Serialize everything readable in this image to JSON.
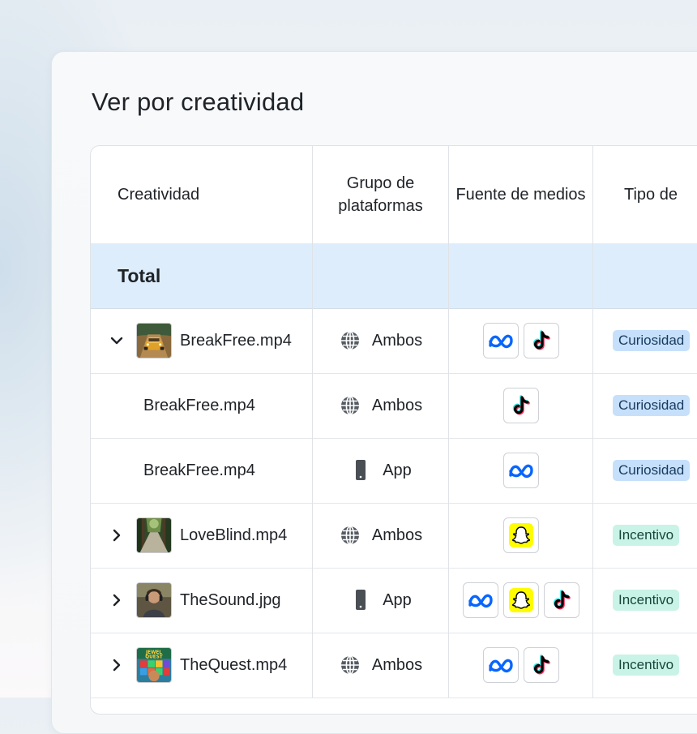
{
  "title": "Ver por creatividad",
  "columns": [
    "Creatividad",
    "Grupo de plataformas",
    "Fuente de medios",
    "Tipo de"
  ],
  "total_label": "Total",
  "colors": {
    "total_row": "#deedfb",
    "badge_curiosidad": "#c6e0fb",
    "badge_incentivo": "#c9f3e6",
    "meta": "#0866ff"
  },
  "rows": [
    {
      "expander": "chevron-down-icon",
      "thumb": "car-thumbnail",
      "name": "BreakFree.mp4",
      "platform_icon": "globe-icon",
      "platform": "Ambos",
      "media": [
        "meta-icon",
        "tiktok-icon"
      ],
      "type": "Curiosidad"
    },
    {
      "expander": "",
      "thumb": "",
      "name": "BreakFree.mp4",
      "platform_icon": "globe-icon",
      "platform": "Ambos",
      "media": [
        "tiktok-icon"
      ],
      "type": "Curiosidad"
    },
    {
      "expander": "",
      "thumb": "",
      "name": "BreakFree.mp4",
      "platform_icon": "phone-icon",
      "platform": "App",
      "media": [
        "meta-icon"
      ],
      "type": "Curiosidad"
    },
    {
      "expander": "chevron-right-icon",
      "thumb": "forest-path-thumbnail",
      "name": "LoveBlind.mp4",
      "platform_icon": "globe-icon",
      "platform": "Ambos",
      "media": [
        "snapchat-icon"
      ],
      "type": "Incentivo"
    },
    {
      "expander": "chevron-right-icon",
      "thumb": "person-headphones-thumbnail",
      "name": "TheSound.jpg",
      "platform_icon": "phone-icon",
      "platform": "App",
      "media": [
        "meta-icon",
        "snapchat-icon",
        "tiktok-icon"
      ],
      "type": "Incentivo"
    },
    {
      "expander": "chevron-right-icon",
      "thumb": "jewel-quest-thumbnail",
      "name": "TheQuest.mp4",
      "platform_icon": "globe-icon",
      "platform": "Ambos",
      "media": [
        "meta-icon",
        "tiktok-icon"
      ],
      "type": "Incentivo"
    }
  ],
  "thumbnail_text": {
    "jewel_quest": "JEWEL QUEST"
  }
}
